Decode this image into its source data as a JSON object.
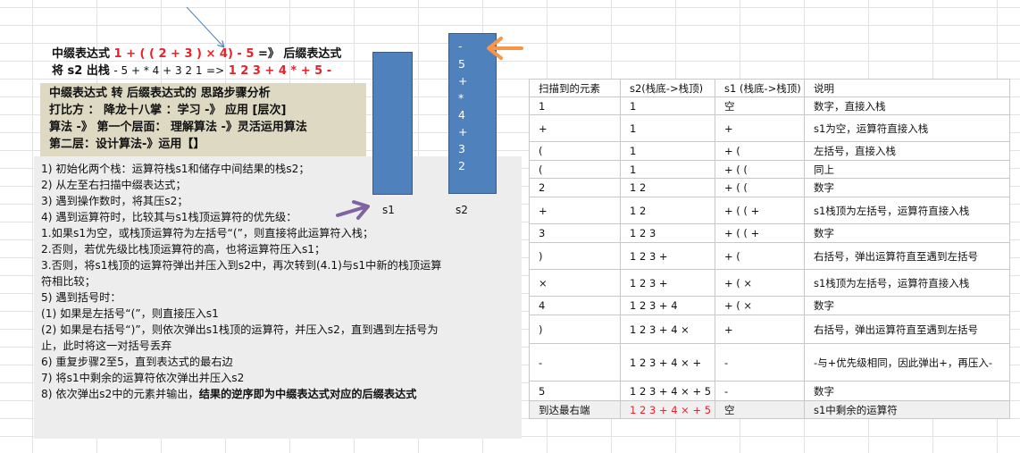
{
  "headline": {
    "infix_label": "中缀表达式",
    "infix_expr": "1 + ( ( 2 + 3 ) × 4) - 5",
    "arrow": "=》",
    "postfix_label": "后缀表达式",
    "line2_label": "将 s2 出栈",
    "line2_expr": "- 5 + * 4 + 3 2 1",
    "line2_arrow": "=>",
    "line2_result": "1 2 3 + 4 * + 5 -"
  },
  "analysis": {
    "lines": [
      "中缀表达式 转 后缀表达式的 思路步骤分析",
      "打比方 ： 降龙十八掌 ：学习 -》 应用 [层次]",
      "算法 -》 第一个层面： 理解算法 -》灵活运用算法",
      "第二层：设计算法-》运用【】"
    ]
  },
  "steps": {
    "lines": [
      "1) 初始化两个栈：运算符栈s1和储存中间结果的栈s2；",
      "2) 从左至右扫描中缀表达式；",
      "3) 遇到操作数时，将其压s2；",
      "4) 遇到运算符时，比较其与s1栈顶运算符的优先级：",
      "1.如果s1为空，或栈顶运算符为左括号“(”，则直接将此运算符入栈；",
      "2.否则，若优先级比栈顶运算符的高，也将运算符压入s1；",
      "3.否则，将s1栈顶的运算符弹出并压入到s2中，再次转到(4.1)与s1中新的栈顶运算",
      "符相比较；",
      "5) 遇到括号时：",
      "(1) 如果是左括号“(”，则直接压入s1",
      "(2) 如果是右括号“)”，则依次弹出s1栈顶的运算符，并压入s2，直到遇到左括号为",
      "止，此时将这一对括号丢弃",
      "6) 重复步骤2至5，直到表达式的最右边",
      "7) 将s1中剩余的运算符依次弹出并压入s2"
    ],
    "last_prefix": "8)  依次弹出s2中的元素并输出，",
    "last_bold": "结果的逆序即为中缀表达式对应的后缀表达式"
  },
  "stacks": {
    "s1_label": "s1",
    "s2_label": "s2",
    "s2_items": [
      "-",
      "5",
      "+",
      "*",
      "4",
      "+",
      "3",
      "2"
    ]
  },
  "table": {
    "headers": [
      "扫描到的元素",
      "s2(栈底->栈顶)",
      "s1 (栈底->栈顶)",
      "说明"
    ],
    "rows": [
      [
        "1",
        "1",
        "空",
        "数字，直接入栈"
      ],
      [
        "+",
        "1",
        "+",
        "s1为空，运算符直接入栈"
      ],
      [
        "(",
        "1",
        "+ (",
        "左括号，直接入栈"
      ],
      [
        "(",
        "1",
        "+ ( (",
        "同上"
      ],
      [
        "2",
        "1 2",
        "+ ( (",
        "数字"
      ],
      [
        "+",
        "1 2",
        "+ ( ( +",
        "s1栈顶为左括号，运算符直接入栈"
      ],
      [
        "3",
        "1 2 3",
        "+ ( ( +",
        "数字"
      ],
      [
        ")",
        "1 2 3 +",
        "+ (",
        "右括号，弹出运算符直至遇到左括号"
      ],
      [
        "×",
        "1 2 3 +",
        "+ ( ×",
        "s1栈顶为左括号，运算符直接入栈"
      ],
      [
        "4",
        "1 2 3 + 4",
        "+ ( ×",
        "数字"
      ],
      [
        ")",
        "1 2 3 + 4 ×",
        "+",
        "右括号，弹出运算符直至遇到左括号"
      ],
      [
        "-",
        "1 2 3 + 4 × +",
        "-",
        "-与+优先级相同，因此弹出+，再压入-"
      ],
      [
        "5",
        "1 2 3 + 4 × + 5",
        "-",
        "数字"
      ],
      [
        "到达最右端",
        "1 2 3 + 4 × + 5 -",
        "空",
        "s1中剩余的运算符"
      ]
    ]
  },
  "colors": {
    "accent_red": "#e8212b",
    "stack_blue": "#4f81bd",
    "analysis_bg": "#ddd9c3",
    "steps_bg": "#ededed",
    "orange_arrow": "#f79646",
    "purple_arrow": "#8064a2",
    "blue_line": "#4f81bd"
  }
}
